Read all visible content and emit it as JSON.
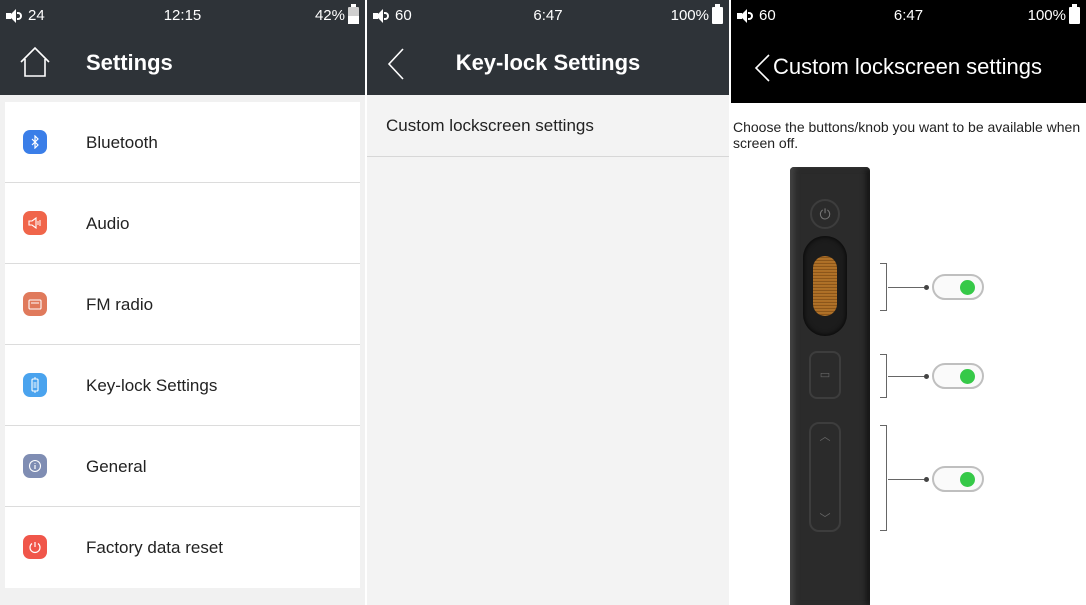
{
  "panel1": {
    "status": {
      "volume": "24",
      "time": "12:15",
      "battery": "42%"
    },
    "title": "Settings",
    "items": [
      {
        "label": "Bluetooth",
        "icon": "bluetooth-icon",
        "color": "#3a7ee8",
        "glyph": "✱"
      },
      {
        "label": "Audio",
        "icon": "audio-icon",
        "color": "#f0654a",
        "glyph": "◁"
      },
      {
        "label": "FM radio",
        "icon": "radio-icon",
        "color": "#e07a5c",
        "glyph": "▤"
      },
      {
        "label": "Key-lock Settings",
        "icon": "keylock-icon",
        "color": "#4aa3ee",
        "glyph": "▯"
      },
      {
        "label": "General",
        "icon": "info-icon",
        "color": "#7f8db3",
        "glyph": "ⓘ"
      },
      {
        "label": "Factory data reset",
        "icon": "reset-icon",
        "color": "#f0564a",
        "glyph": "↻"
      }
    ]
  },
  "panel2": {
    "status": {
      "volume": "60",
      "time": "6:47",
      "battery": "100%"
    },
    "title": "Key-lock Settings",
    "item": "Custom lockscreen settings"
  },
  "panel3": {
    "status": {
      "volume": "60",
      "time": "6:47",
      "battery": "100%"
    },
    "title": "Custom lockscreen settings",
    "description": "Choose the buttons/knob you want to be available when screen off.",
    "toggles": [
      {
        "name": "knob-toggle",
        "on": true
      },
      {
        "name": "middle-button-toggle",
        "on": true
      },
      {
        "name": "volume-buttons-toggle",
        "on": true
      }
    ]
  },
  "colors": {
    "toolbar": "#2e3338",
    "toggle_on": "#36c948",
    "knob": "#c07a2a"
  }
}
